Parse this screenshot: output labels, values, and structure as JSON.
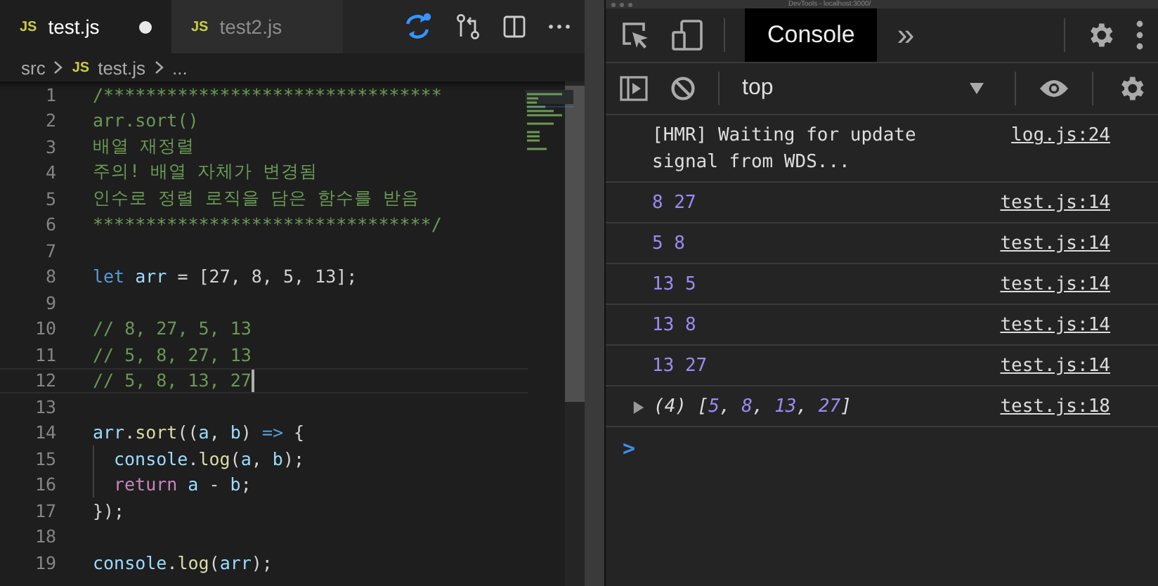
{
  "editor": {
    "tabs": [
      {
        "badge": "JS",
        "label": "test.js",
        "selected": true,
        "dirty": true
      },
      {
        "badge": "JS",
        "label": "test2.js",
        "selected": false,
        "dirty": false
      }
    ],
    "breadcrumb": {
      "folder": "src",
      "badge": "JS",
      "file": "test.js",
      "more": "..."
    },
    "lines": [
      {
        "number": "1",
        "tokens": [
          {
            "text": "/********************************",
            "kind": "comment"
          }
        ]
      },
      {
        "number": "2",
        "tokens": [
          {
            "text": "arr.sort()",
            "kind": "comment"
          }
        ]
      },
      {
        "number": "3",
        "tokens": [
          {
            "text": "배열 재정렬",
            "kind": "comment"
          }
        ]
      },
      {
        "number": "4",
        "tokens": [
          {
            "text": "주의! 배열 자체가 변경됨",
            "kind": "comment"
          }
        ]
      },
      {
        "number": "5",
        "tokens": [
          {
            "text": "인수로 정렬 로직을 담은 함수를 받음",
            "kind": "comment"
          }
        ]
      },
      {
        "number": "6",
        "tokens": [
          {
            "text": "********************************/",
            "kind": "comment"
          }
        ]
      },
      {
        "number": "7"
      },
      {
        "number": "8",
        "tokens": [
          {
            "text": "let",
            "kind": "keyword"
          },
          {
            "text": " arr",
            "kind": "variable"
          },
          {
            "text": " = [27, 8, 5, 13];",
            "kind": "plain"
          }
        ]
      },
      {
        "number": "9"
      },
      {
        "number": "10",
        "tokens": [
          {
            "text": "// 8, 27, 5, 13",
            "kind": "comment"
          }
        ]
      },
      {
        "number": "11",
        "tokens": [
          {
            "text": "// 5, 8, 27, 13",
            "kind": "comment"
          }
        ]
      },
      {
        "number": "12",
        "current": true,
        "tokens": [
          {
            "text": "// 5, 8, 13, 27",
            "kind": "comment"
          }
        ]
      },
      {
        "number": "13"
      },
      {
        "number": "14",
        "tokens": [
          {
            "text": "arr",
            "kind": "variable"
          },
          {
            "text": ".",
            "kind": "plain"
          },
          {
            "text": "sort",
            "kind": "function"
          },
          {
            "text": "((",
            "kind": "plain"
          },
          {
            "text": "a",
            "kind": "variable"
          },
          {
            "text": ", ",
            "kind": "plain"
          },
          {
            "text": "b",
            "kind": "variable"
          },
          {
            "text": ") ",
            "kind": "plain"
          },
          {
            "text": "=>",
            "kind": "keyword"
          },
          {
            "text": " {",
            "kind": "plain"
          }
        ]
      },
      {
        "number": "15",
        "indent": true,
        "tokens": [
          {
            "text": "console",
            "kind": "variable"
          },
          {
            "text": ".",
            "kind": "plain"
          },
          {
            "text": "log",
            "kind": "function"
          },
          {
            "text": "(",
            "kind": "plain"
          },
          {
            "text": "a",
            "kind": "variable"
          },
          {
            "text": ", ",
            "kind": "plain"
          },
          {
            "text": "b",
            "kind": "variable"
          },
          {
            "text": ");",
            "kind": "plain"
          }
        ]
      },
      {
        "number": "16",
        "indent": true,
        "tokens": [
          {
            "text": "return",
            "kind": "control"
          },
          {
            "text": " a",
            "kind": "variable"
          },
          {
            "text": " - ",
            "kind": "plain"
          },
          {
            "text": "b",
            "kind": "variable"
          },
          {
            "text": ";",
            "kind": "plain"
          }
        ]
      },
      {
        "number": "17",
        "tokens": [
          {
            "text": "});",
            "kind": "plain"
          }
        ]
      },
      {
        "number": "18"
      },
      {
        "number": "19",
        "tokens": [
          {
            "text": "console",
            "kind": "variable"
          },
          {
            "text": ".",
            "kind": "plain"
          },
          {
            "text": "log",
            "kind": "function"
          },
          {
            "text": "(",
            "kind": "plain"
          },
          {
            "text": "arr",
            "kind": "variable"
          },
          {
            "text": ");",
            "kind": "plain"
          }
        ]
      }
    ]
  },
  "devtools": {
    "title": "DevTools - localhost:3000/",
    "tabs": [
      {
        "label": "Console",
        "selected": true
      }
    ],
    "more": "»",
    "context": "top",
    "messages": [
      {
        "kind": "text",
        "text": "[HMR] Waiting for update signal from WDS...",
        "source": "log.js:24"
      },
      {
        "kind": "values",
        "text": "8 27",
        "source": "test.js:14"
      },
      {
        "kind": "values",
        "text": "5 8",
        "source": "test.js:14"
      },
      {
        "kind": "values",
        "text": "13 5",
        "source": "test.js:14"
      },
      {
        "kind": "values",
        "text": "13 8",
        "source": "test.js:14"
      },
      {
        "kind": "values",
        "text": "13 27",
        "source": "test.js:14"
      },
      {
        "kind": "array",
        "expanded": false,
        "tokens": [
          {
            "text": "(4) [",
            "kind": "punct"
          },
          {
            "text": "5",
            "kind": "number"
          },
          {
            "text": ", ",
            "kind": "punct"
          },
          {
            "text": "8",
            "kind": "number"
          },
          {
            "text": ", ",
            "kind": "punct"
          },
          {
            "text": "13",
            "kind": "number"
          },
          {
            "text": ", ",
            "kind": "punct"
          },
          {
            "text": "27",
            "kind": "number"
          },
          {
            "text": "]",
            "kind": "punct"
          }
        ],
        "source": "test.js:18"
      }
    ],
    "prompt": ">"
  }
}
